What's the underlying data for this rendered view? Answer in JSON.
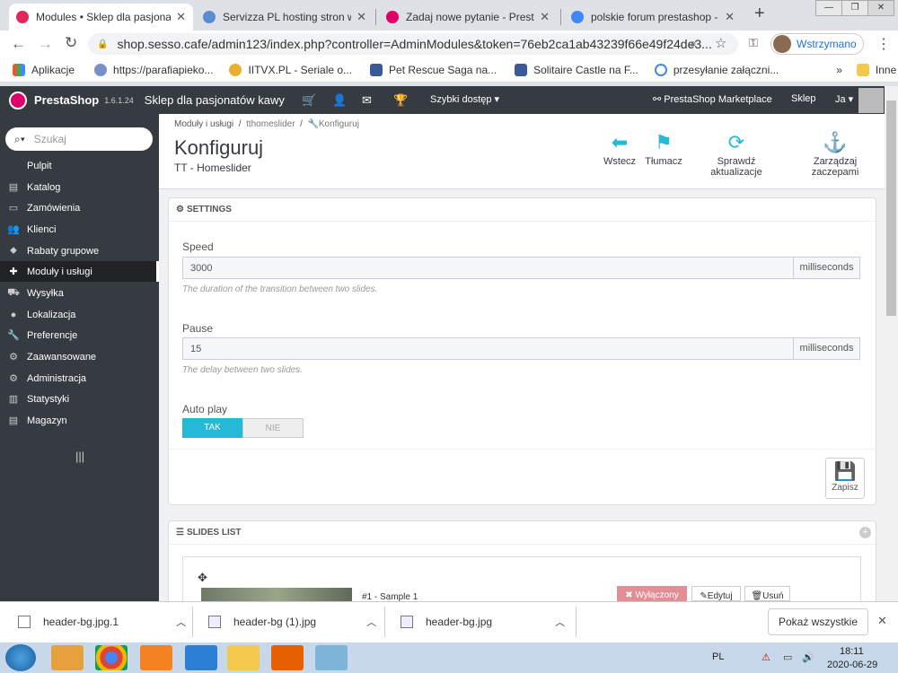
{
  "tabs": [
    {
      "title": "Modules • Sklep dla pasjonat",
      "color": "#e2275b"
    },
    {
      "title": "Servizza PL hosting stron ww",
      "color": "#5b8bd0"
    },
    {
      "title": "Zadaj nowe pytanie - PrestaS",
      "color": "#df0067"
    },
    {
      "title": "polskie forum prestashop - S",
      "color": "#4285f4"
    }
  ],
  "url": "shop.sesso.cafe/admin123/index.php?controller=AdminModules&token=76eb2ca1ab43239f66e49f24de3...",
  "profile_label": "Wstrzymano",
  "bookmarks": [
    "Aplikacje",
    "https://parafiapieko...",
    "IITVX.PL - Seriale o...",
    "Pet Rescue Saga na...",
    "Solitaire Castle na F...",
    "przesyłanie załączni...",
    "»",
    "Inne zakładki"
  ],
  "header": {
    "brand": "PrestaShop",
    "version": "1.6.1.24",
    "shop": "Sklep dla pasjonatów kawy",
    "quick": "Szybki dostęp ▾",
    "marketplace": "PrestaShop Marketplace",
    "shop_link": "Sklep",
    "user": "Ja ▾"
  },
  "sidebar": {
    "search_placeholder": "Szukaj",
    "items": [
      "Pulpit",
      "Katalog",
      "Zamówienia",
      "Klienci",
      "Rabaty grupowe",
      "Moduły i usługi",
      "Wysyłka",
      "Lokalizacja",
      "Preferencje",
      "Zaawansowane",
      "Administracja",
      "Statystyki",
      "Magazyn"
    ],
    "active": 5
  },
  "breadcrumb": [
    "Moduły i usługi",
    "/",
    "tthomeslider",
    "/",
    "Konfiguruj"
  ],
  "page_title": "Konfiguruj",
  "page_subtitle": "TT - Homeslider",
  "toolbar": [
    "Wstecz",
    "Tłumacz",
    "Sprawdź aktualizacje",
    "Zarządzaj zaczepami"
  ],
  "settings": {
    "heading": "SETTINGS",
    "speed_label": "Speed",
    "speed_value": "3000",
    "speed_unit": "milliseconds",
    "speed_help": "The duration of the transition between two slides.",
    "pause_label": "Pause",
    "pause_value": "15",
    "pause_unit": "milliseconds",
    "pause_help": "The delay between two slides.",
    "autoplay_label": "Auto play",
    "yes": "TAK",
    "no": "NIE",
    "save": "Zapisz"
  },
  "slides": {
    "heading": "SLIDES LIST",
    "item": "#1 - Sample 1",
    "disabled": "✖ Wyłączony",
    "edit": "Edytuj",
    "delete": "Usuń"
  },
  "downloads": [
    "header-bg.jpg.1",
    "header-bg (1).jpg",
    "header-bg.jpg"
  ],
  "show_all": "Pokaż wszystkie",
  "tray": {
    "lang": "PL",
    "time": "18:11",
    "date": "2020-06-29"
  }
}
